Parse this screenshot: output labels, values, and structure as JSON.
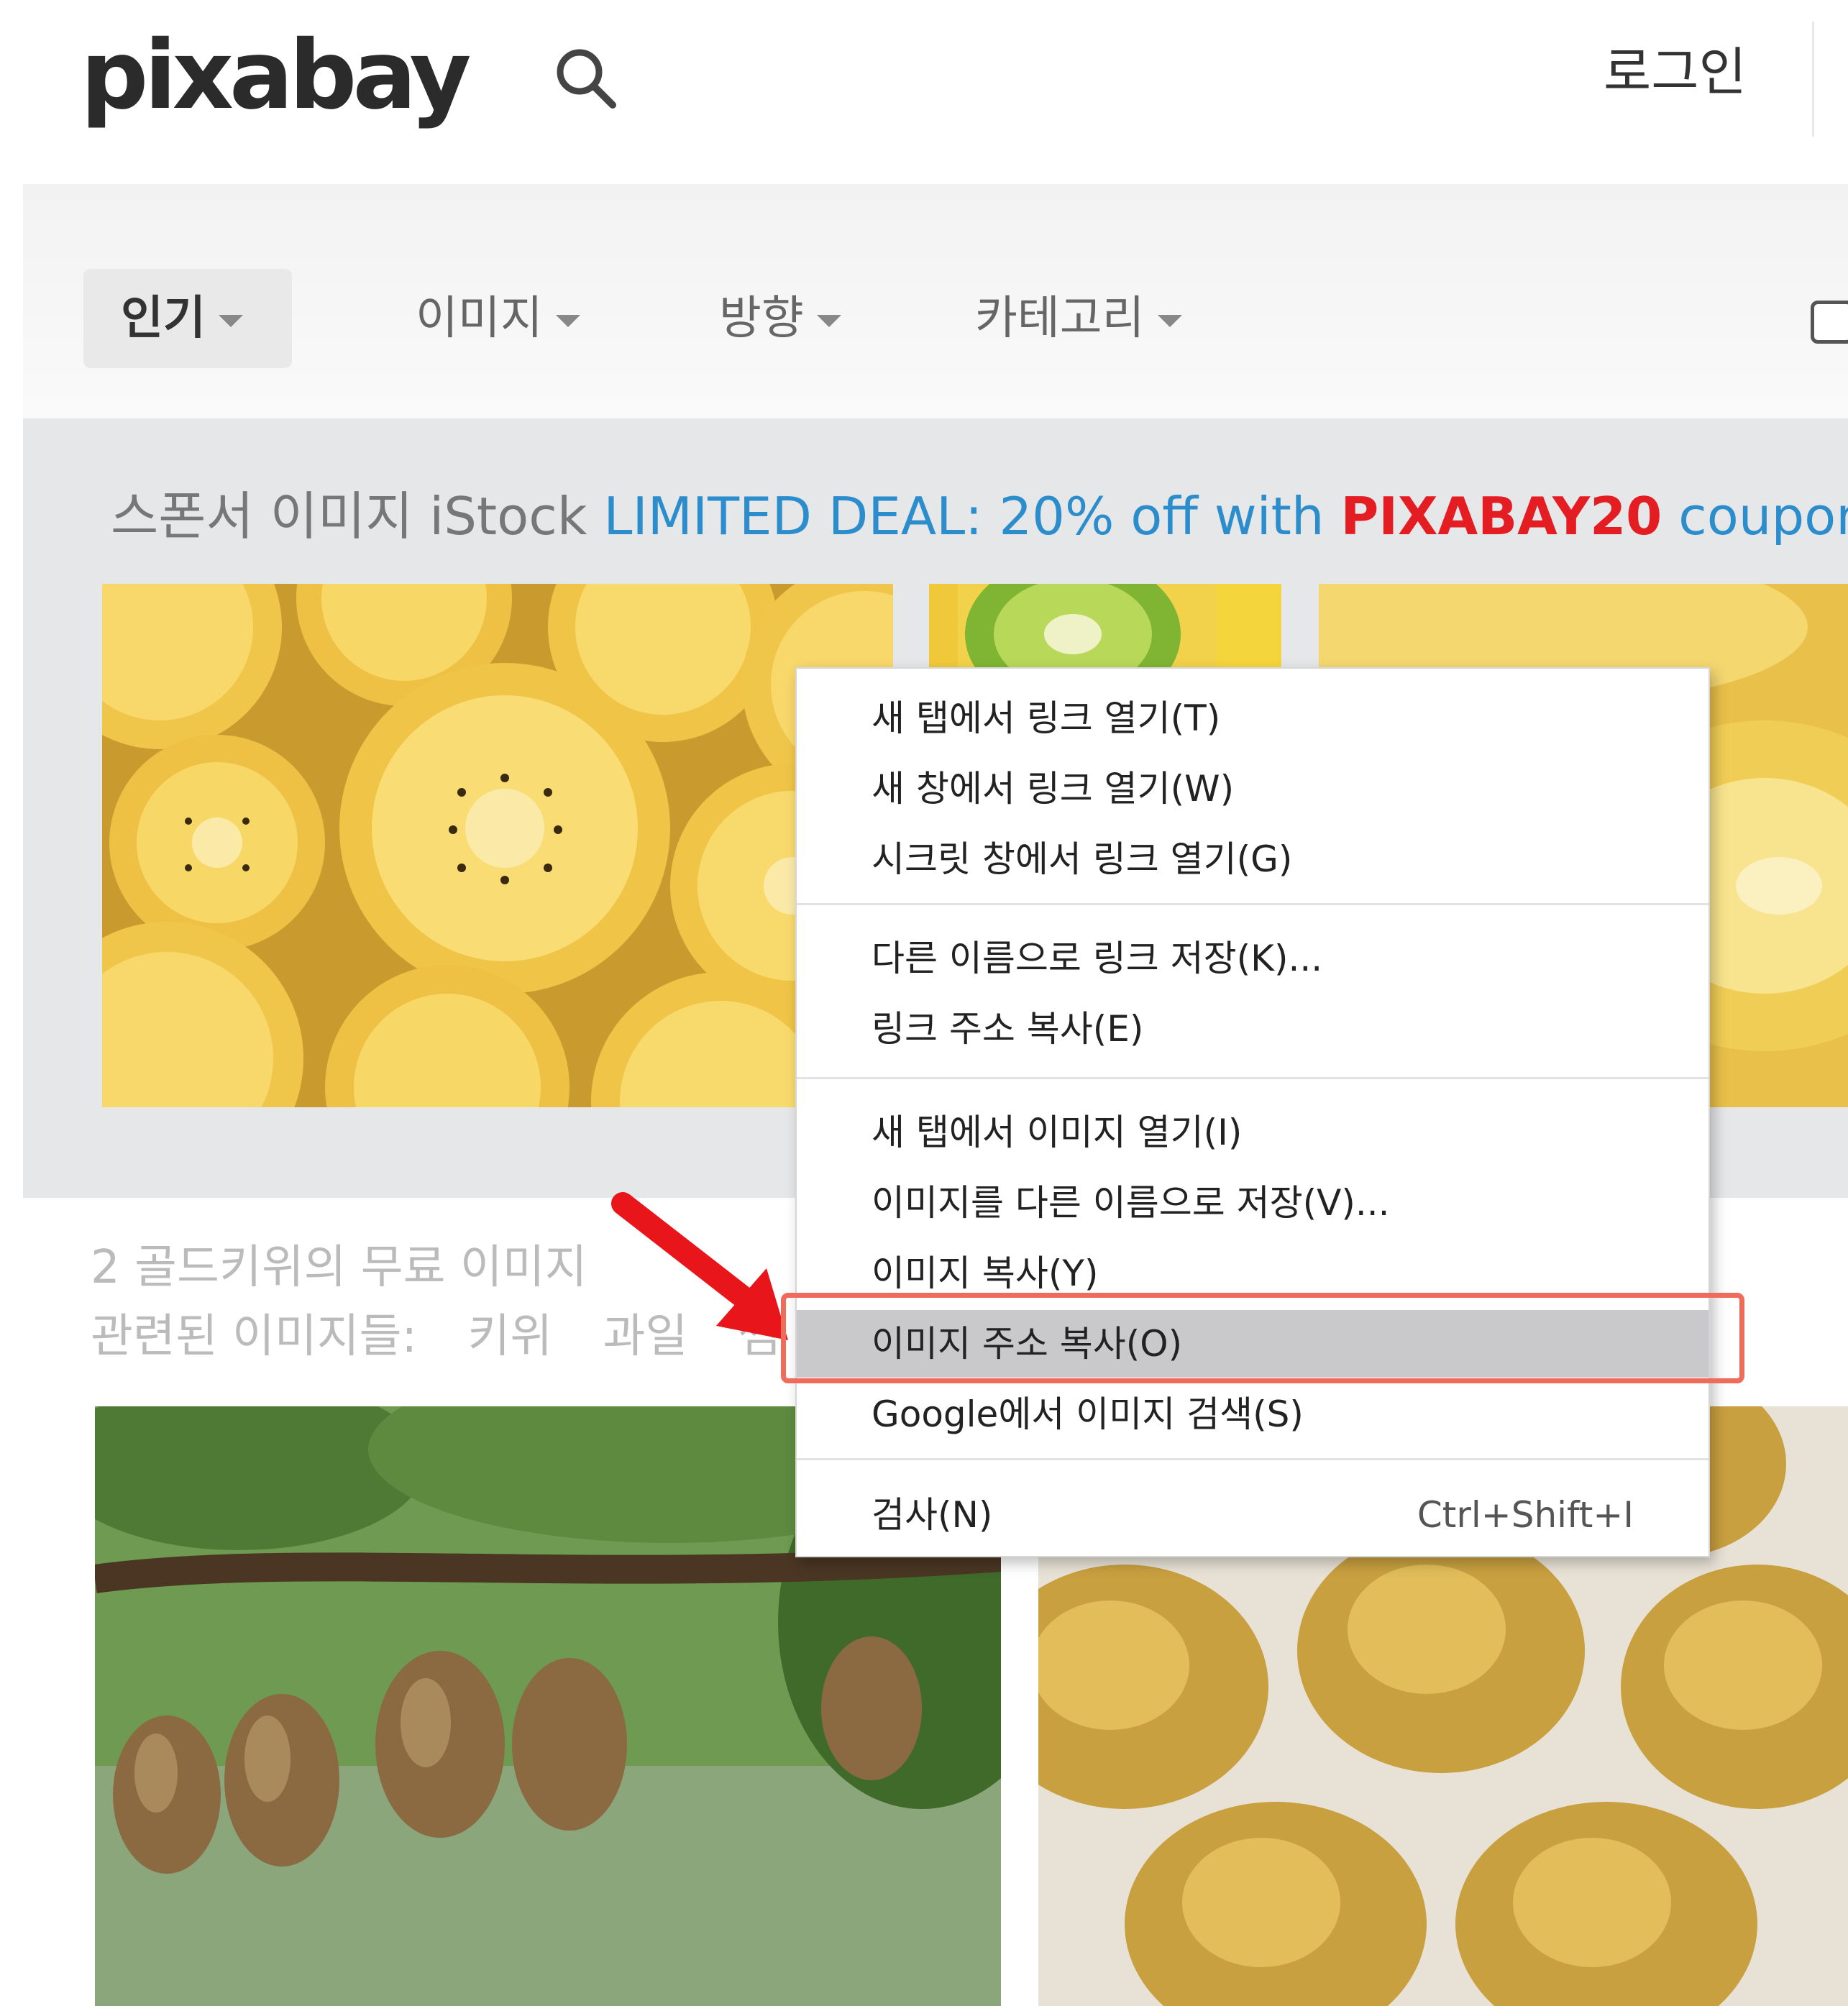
{
  "header": {
    "logo": "pixabay",
    "search_icon": "search-icon",
    "login": "로그인"
  },
  "filters": [
    {
      "label": "인기",
      "active": true
    },
    {
      "label": "이미지",
      "active": false
    },
    {
      "label": "방향",
      "active": false
    },
    {
      "label": "카테고리",
      "active": false
    }
  ],
  "sponsor": {
    "prefix": "스폰서 이미지 iStock",
    "deal": "LIMITED DEAL: 20% off with",
    "code": "PIXABAY20",
    "suffix": "coupon"
  },
  "results": {
    "title": "2 골드키위의 무료 이미지",
    "related_label": "관련된 이미지들:",
    "related_tags": [
      "키위",
      "과일",
      "썸"
    ]
  },
  "context_menu": {
    "items": [
      {
        "label": "새 탭에서 링크 열기(T)"
      },
      {
        "label": "새 창에서 링크 열기(W)"
      },
      {
        "label": "시크릿 창에서 링크 열기(G)"
      },
      {
        "label": "다른 이름으로 링크 저장(K)..."
      },
      {
        "label": "링크 주소 복사(E)"
      },
      {
        "label": "새 탭에서 이미지 열기(I)"
      },
      {
        "label": "이미지를 다른 이름으로 저장(V)..."
      },
      {
        "label": "이미지 복사(Y)"
      },
      {
        "label": "이미지 주소 복사(O)",
        "highlighted": true
      },
      {
        "label": "Google에서 이미지 검색(S)"
      },
      {
        "label": "검사(N)",
        "shortcut": "Ctrl+Shift+I"
      }
    ]
  },
  "colors": {
    "sponsor_blue": "#2c8dcd",
    "sponsor_red": "#e41d22",
    "highlight_border": "#ef6b5b",
    "arrow_red": "#e8161b"
  }
}
